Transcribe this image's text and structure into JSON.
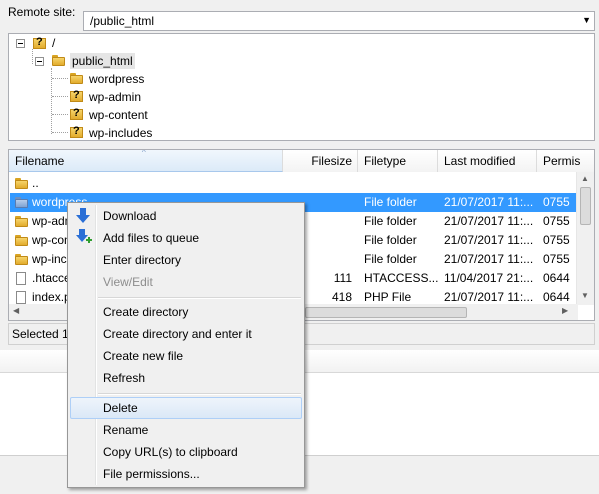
{
  "remote_site": {
    "label": "Remote site:",
    "path": "/public_html"
  },
  "tree": {
    "root": "/",
    "node": "public_html",
    "children": [
      "wordpress",
      "wp-admin",
      "wp-content",
      "wp-includes"
    ]
  },
  "list": {
    "columns": [
      "Filename",
      "Filesize",
      "Filetype",
      "Last modified",
      "Permis"
    ],
    "rows": [
      {
        "name": "..",
        "size": "",
        "type": "",
        "modified": "",
        "perms": ""
      },
      {
        "name": "wordpress",
        "size": "",
        "type": "File folder",
        "modified": "21/07/2017 11:...",
        "perms": "0755"
      },
      {
        "name": "wp-admin",
        "size": "",
        "type": "File folder",
        "modified": "21/07/2017 11:...",
        "perms": "0755"
      },
      {
        "name": "wp-content",
        "size": "",
        "type": "File folder",
        "modified": "21/07/2017 11:...",
        "perms": "0755"
      },
      {
        "name": "wp-includes",
        "size": "",
        "type": "File folder",
        "modified": "21/07/2017 11:...",
        "perms": "0755"
      },
      {
        "name": ".htaccess",
        "size": "111",
        "type": "HTACCESS...",
        "modified": "11/04/2017 21:...",
        "perms": "0644"
      },
      {
        "name": "index.php",
        "size": "418",
        "type": "PHP File",
        "modified": "21/07/2017 11:...",
        "perms": "0644"
      }
    ]
  },
  "status": {
    "selected": "Selected 1"
  },
  "context_menu": {
    "items": [
      "Download",
      "Add files to queue",
      "Enter directory",
      "View/Edit",
      "Create directory",
      "Create directory and enter it",
      "Create new file",
      "Refresh",
      "Delete",
      "Rename",
      "Copy URL(s) to clipboard",
      "File permissions..."
    ]
  },
  "colors": {
    "selection": "#3399ff",
    "menu_hover": "#dbe8f7"
  }
}
